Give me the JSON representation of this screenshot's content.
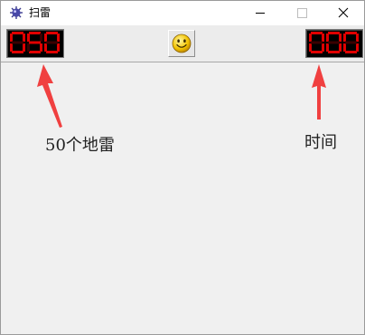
{
  "window": {
    "title": "扫雷",
    "app_icon": "mine-icon"
  },
  "title_buttons": {
    "minimize_icon": "minimize-icon",
    "maximize_icon": "maximize-icon",
    "close_icon": "close-icon"
  },
  "toolbar": {
    "mine_counter": "050",
    "timer": "000",
    "reset_icon": "smiley-face-icon"
  },
  "annotations": {
    "mines_label": "50个地雷",
    "time_label": "时间"
  },
  "colors": {
    "led_on": "#e00000",
    "led_off": "#3a0000",
    "arrow": "#f04040"
  }
}
